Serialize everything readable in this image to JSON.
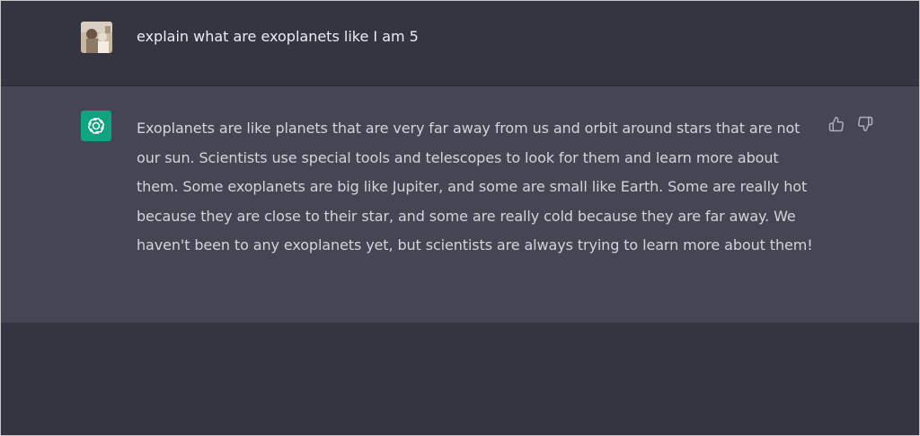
{
  "conversation": {
    "user_message": {
      "text": "explain what are exoplanets like I am 5",
      "avatar_icon": "user-photo-avatar"
    },
    "assistant_message": {
      "text": "Exoplanets are like planets that are very far away from us and orbit around stars that are not our sun. Scientists use special tools and telescopes to look for them and learn more about them. Some exoplanets are big like Jupiter, and some are small like Earth. Some are really hot because they are close to their star, and some are really cold because they are far away. We haven't been to any exoplanets yet, but scientists are always trying to learn more about them!",
      "avatar_icon": "openai-logo-icon",
      "feedback_icons": [
        "thumbs-up-icon",
        "thumbs-down-icon"
      ]
    }
  },
  "colors": {
    "background": "#343541",
    "assistant_background": "#444654",
    "text": "#d1d5db",
    "user_text": "#ececf1",
    "accent": "#10a37f",
    "icon": "#acacbe"
  }
}
